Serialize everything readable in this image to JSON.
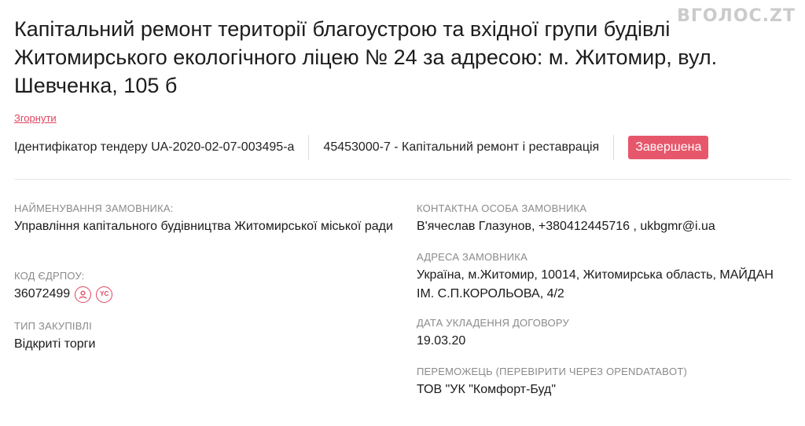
{
  "watermark": "ВГОЛОС.ZT",
  "title": "Капітальний ремонт території благоустрою та вхідної групи будівлі Житомирського екологічного ліцею № 24 за адресою: м. Житомир, вул. Шевченка, 105 б",
  "collapse_label": "Згорнути",
  "meta": {
    "tender_id": "Ідентифікатор тендеру UA-2020-02-07-003495-a",
    "cpv": "45453000-7 - Капітальний ремонт і реставрація",
    "status": "Завершена"
  },
  "colors": {
    "accent": "#e0445e",
    "badge": "#e6576b",
    "label": "#8a8a8a"
  },
  "left": {
    "customer_label": "НАЙМЕНУВАННЯ ЗАМОВНИКА:",
    "customer_value": "Управління капітального будівництва Житомирської міської ради",
    "edrpou_label": "КОД ЄДРПОУ:",
    "edrpou_value": "36072499",
    "edrpou_icons": [
      "person-icon",
      "yc-icon"
    ],
    "yc_icon_text": "YC",
    "procurement_type_label": "ТИП ЗАКУПІВЛІ",
    "procurement_type_value": "Відкриті торги"
  },
  "right": {
    "contact_label": "КОНТАКТНА ОСОБА ЗАМОВНИКА",
    "contact_value": "В'ячеслав Глазунов, +380412445716 , ukbgmr@i.ua",
    "address_label": "АДРЕСА ЗАМОВНИКА",
    "address_value": "Україна, м.Житомир, 10014, Житомирська область, МАЙДАН ІМ. С.П.КОРОЛЬОВА, 4/2",
    "contract_date_label": "ДАТА УКЛАДЕННЯ ДОГОВОРУ",
    "contract_date_value": "19.03.20",
    "winner_label": "ПЕРЕМОЖЕЦЬ (ПЕРЕВІРИТИ ЧЕРЕЗ OPENDATABOT)",
    "winner_value": "ТОВ \"УК \"Комфорт-Буд\""
  }
}
